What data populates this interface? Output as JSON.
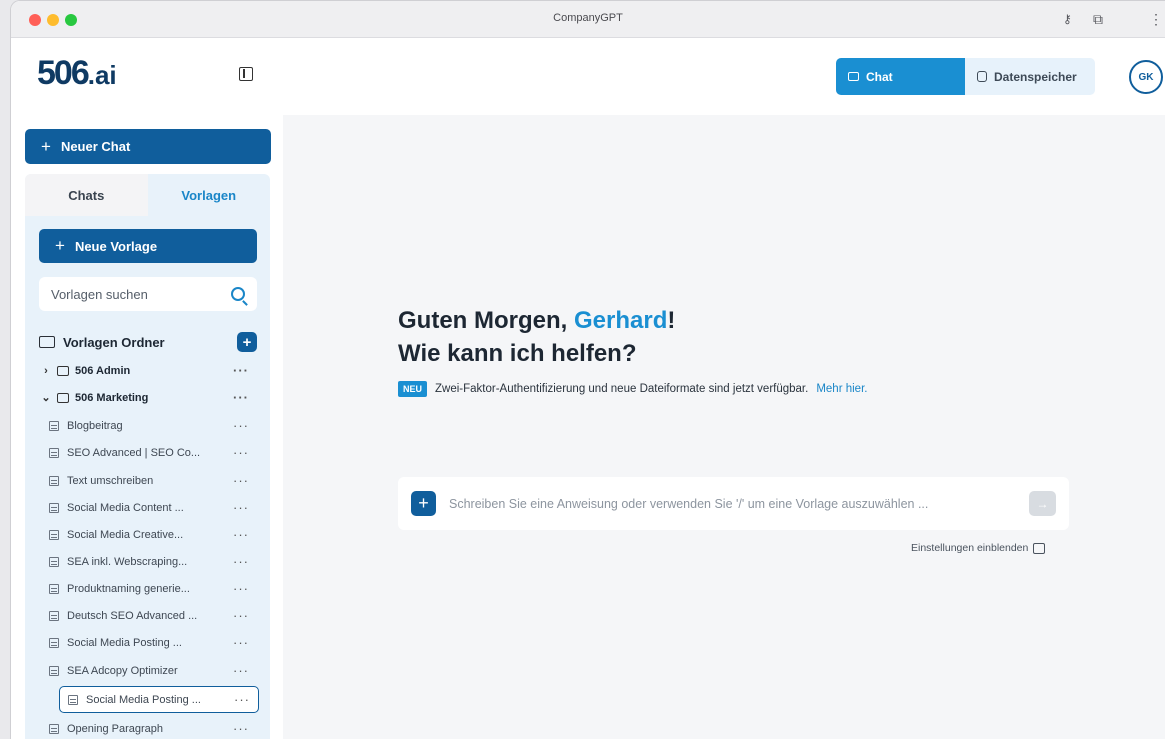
{
  "window": {
    "title": "CompanyGPT"
  },
  "brand": {
    "logo_main": "506",
    "logo_suffix": ".ai"
  },
  "sidebar": {
    "new_chat": "Neuer Chat",
    "tabs": [
      {
        "label": "Chats"
      },
      {
        "label": "Vorlagen"
      }
    ],
    "new_template": "Neue Vorlage",
    "search_placeholder": "Vorlagen suchen",
    "folder_header": "Vorlagen Ordner",
    "groups": [
      {
        "label": "506 Admin",
        "expanded": false
      },
      {
        "label": "506 Marketing",
        "expanded": true
      }
    ],
    "templates": [
      "Blogbeitrag",
      "SEO Advanced | SEO Co...",
      "Text umschreiben",
      "Social Media Content ...",
      "Social Media Creative...",
      "SEA inkl. Webscraping...",
      "Produktnaming generie...",
      "Deutsch SEO Advanced ...",
      "Social Media Posting ...",
      "SEA Adcopy Optimizer",
      "Social Media Posting ...",
      "Opening Paragraph"
    ],
    "more": "···"
  },
  "topbar": {
    "chat_label": "Chat",
    "data_label": "Datenspeicher",
    "avatar_initials": "GK"
  },
  "main": {
    "greeting_prefix": "Guten Morgen, ",
    "user_name": "Gerhard",
    "greeting_suffix": "!",
    "question": "Wie kann ich helfen?",
    "badge": "NEU",
    "notice": "Zwei-Faktor-Authentifizierung und neue Dateiformate sind jetzt verfügbar.",
    "notice_link": "Mehr hier.",
    "composer_placeholder": "Schreiben Sie eine Anweisung oder verwenden Sie '/' um eine Vorlage auszuwählen ...",
    "settings_toggle": "Einstellungen einblenden"
  },
  "colors": {
    "primary": "#105e9c",
    "accent": "#1a8fd2",
    "panel": "#e8f2fa"
  }
}
